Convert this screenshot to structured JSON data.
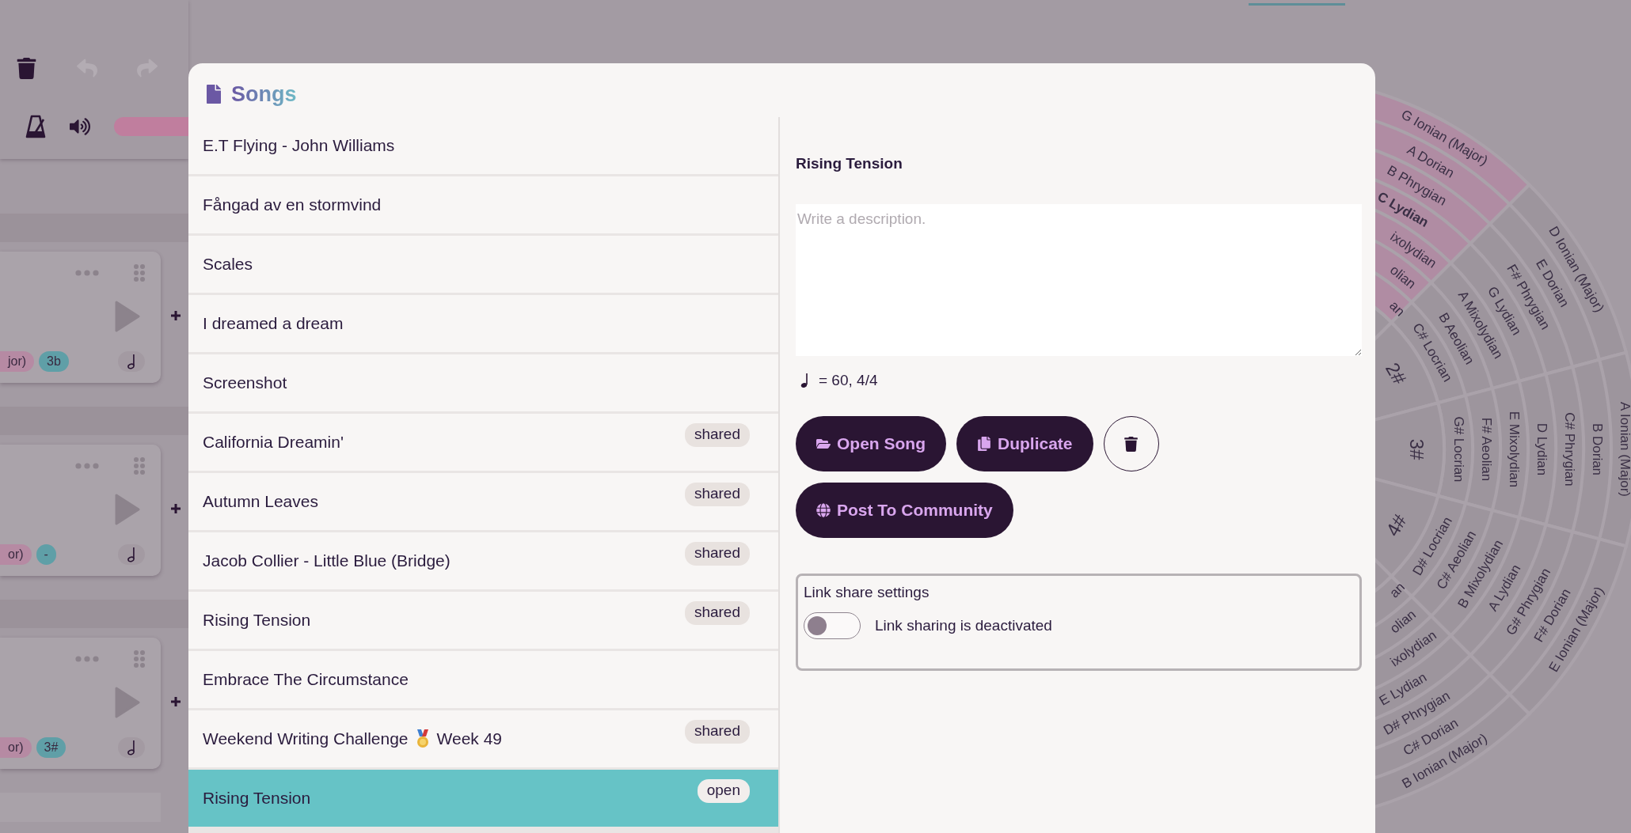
{
  "toolbar": {
    "buttons": [
      {
        "kind": "trash",
        "disabled": false
      },
      {
        "kind": "undo",
        "disabled": true
      },
      {
        "kind": "redo",
        "disabled": true
      }
    ]
  },
  "cards": [
    {
      "mode_chip": "jor)",
      "key_chip": "3b"
    },
    {
      "mode_chip": "or)",
      "key_chip": "-"
    },
    {
      "mode_chip": "or)",
      "key_chip": "3#"
    }
  ],
  "wheel": {
    "sectors": [
      {
        "highlighted": true,
        "labels": [
          {
            "text": "G Ionian (Major)",
            "kind": "full",
            "selected": false
          },
          {
            "text": "A Dorian",
            "kind": "full",
            "selected": false
          },
          {
            "text": "B Phrygian",
            "kind": "full",
            "selected": false
          },
          {
            "text": "C Lydian",
            "kind": "full",
            "selected": true
          },
          {
            "text": "ixolydian",
            "kind": "cut",
            "selected": false
          },
          {
            "text": "olian",
            "kind": "cut",
            "selected": false
          },
          {
            "text": "an",
            "kind": "cut",
            "selected": false
          }
        ]
      },
      {
        "highlighted": false,
        "key": "2#",
        "labels": [
          {
            "text": "D Ionian (Major)",
            "kind": "full",
            "selected": false
          },
          {
            "text": "E Dorian",
            "kind": "full",
            "selected": false
          },
          {
            "text": "F# Phrygian",
            "kind": "full",
            "selected": false
          },
          {
            "text": "G Lydian",
            "kind": "full",
            "selected": false
          },
          {
            "text": "A Mixolydian",
            "kind": "full",
            "selected": false
          },
          {
            "text": "B Aeolian",
            "kind": "full",
            "selected": false
          },
          {
            "text": "C# Locrian",
            "kind": "full",
            "selected": false
          }
        ]
      },
      {
        "highlighted": false,
        "key": "3#",
        "labels": [
          {
            "text": "A Ionian (Major)",
            "kind": "full",
            "selected": false
          },
          {
            "text": "B Dorian",
            "kind": "full",
            "selected": false
          },
          {
            "text": "C# Phrygian",
            "kind": "full",
            "selected": false
          },
          {
            "text": "D Lydian",
            "kind": "full",
            "selected": false
          },
          {
            "text": "E Mixolydian",
            "kind": "full",
            "selected": false
          },
          {
            "text": "F# Aeolian",
            "kind": "full",
            "selected": false
          },
          {
            "text": "G# Locrian",
            "kind": "full",
            "selected": false
          }
        ]
      },
      {
        "highlighted": false,
        "key": "4#",
        "labels": [
          {
            "text": "E Ionian (Major)",
            "kind": "full",
            "selected": false
          },
          {
            "text": "F# Dorian",
            "kind": "full",
            "selected": false
          },
          {
            "text": "G# Phrygian",
            "kind": "full",
            "selected": false
          },
          {
            "text": "A Lydian",
            "kind": "full",
            "selected": false
          },
          {
            "text": "B Mixolydian",
            "kind": "full",
            "selected": false
          },
          {
            "text": "C# Aeolian",
            "kind": "full",
            "selected": false
          },
          {
            "text": "D# Locrian",
            "kind": "full",
            "selected": false
          }
        ]
      },
      {
        "highlighted": false,
        "labels": [
          {
            "text": "B Ionian (Major)",
            "kind": "full",
            "selected": false
          },
          {
            "text": "C# Dorian",
            "kind": "full",
            "selected": false
          },
          {
            "text": "D# Phrygian",
            "kind": "full",
            "selected": false
          },
          {
            "text": "E Lydian",
            "kind": "full",
            "selected": false
          },
          {
            "text": "ixolydian",
            "kind": "cut",
            "selected": false
          },
          {
            "text": "olian",
            "kind": "cut",
            "selected": false
          },
          {
            "text": "an",
            "kind": "cut",
            "selected": false
          }
        ]
      }
    ]
  },
  "dialog": {
    "title": "Songs",
    "songs": [
      {
        "title": "E.T Flying - John Williams",
        "selected": false
      },
      {
        "title": "Fångad av en stormvind",
        "selected": false
      },
      {
        "title": "Scales",
        "selected": false
      },
      {
        "title": "I dreamed a dream",
        "selected": false
      },
      {
        "title": "Screenshot",
        "selected": false
      },
      {
        "title": "California Dreamin'",
        "badge": "shared",
        "selected": false
      },
      {
        "title": "Autumn Leaves",
        "badge": "shared",
        "selected": false
      },
      {
        "title": "Jacob Collier - Little Blue (Bridge)",
        "badge": "shared",
        "selected": false
      },
      {
        "title": "Rising Tension",
        "badge": "shared",
        "selected": false
      },
      {
        "title": "Embrace The Circumstance",
        "selected": false
      },
      {
        "title": "Weekend Writing Challenge",
        "title_after": "Week 49",
        "badge": "shared",
        "selected": false
      },
      {
        "title": "Rising Tension",
        "badge": "open",
        "selected": true
      }
    ],
    "detail": {
      "title": "Rising Tension",
      "description": {
        "placeholder": "Write a description."
      },
      "tempo": "= 60, 4/4",
      "buttons": [
        {
          "kind": "open",
          "label": "Open Song"
        },
        {
          "kind": "duplicate",
          "label": "Duplicate"
        },
        {
          "kind": "delete"
        },
        {
          "kind": "post",
          "label": "Post To Community"
        }
      ],
      "link_share": {
        "title": "Link share settings",
        "on": false,
        "label": "Link sharing is deactivated"
      }
    }
  }
}
